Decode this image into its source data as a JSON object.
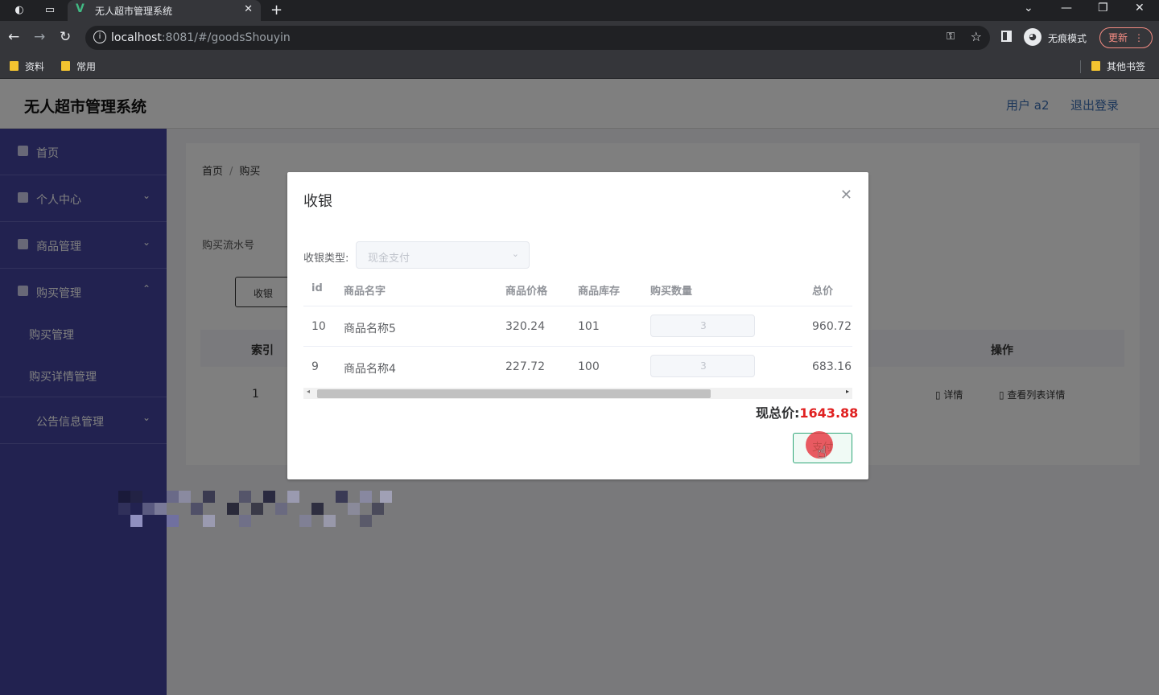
{
  "browser": {
    "tab_title": "无人超市管理系统",
    "tab_close": "✕",
    "new_tab": "+",
    "url_host": "localhost",
    "url_rest": ":8081/#/goodsShouyin",
    "incognito_label": "无痕模式",
    "update_label": "更新",
    "bookmarks": [
      "资料",
      "常用"
    ],
    "other_bookmarks": "其他书签"
  },
  "app": {
    "title": "无人超市管理系统",
    "user": "用户 a2",
    "logout": "退出登录",
    "sidebar": {
      "items": [
        {
          "label": "首页"
        },
        {
          "label": "个人中心"
        },
        {
          "label": "商品管理"
        },
        {
          "label": "购买管理"
        },
        {
          "label": "公告信息管理"
        }
      ],
      "submenu": [
        "购买管理",
        "购买详情管理"
      ]
    },
    "breadcrumb": {
      "home": "首页",
      "sep": "/",
      "current": "购买"
    },
    "search_label": "购买流水号",
    "shouyin_button": "收银",
    "table": {
      "index_header": "索引",
      "op_header": "操作",
      "row_index": "1",
      "detail": "详情",
      "list_detail": "查看列表详情"
    }
  },
  "dialog": {
    "title": "收银",
    "close": "✕",
    "type_label": "收银类型:",
    "type_value": "现金支付",
    "columns": [
      "id",
      "商品名字",
      "商品价格",
      "商品库存",
      "购买数量",
      "总价"
    ],
    "rows": [
      {
        "id": "10",
        "name": "商品名称5",
        "price": "320.24",
        "stock": "101",
        "qty": "3",
        "total": "960.72"
      },
      {
        "id": "9",
        "name": "商品名称4",
        "price": "227.72",
        "stock": "100",
        "qty": "3",
        "total": "683.16"
      }
    ],
    "total_label": "现总价:",
    "total_value": "1643.88",
    "pay_button": "支付"
  }
}
